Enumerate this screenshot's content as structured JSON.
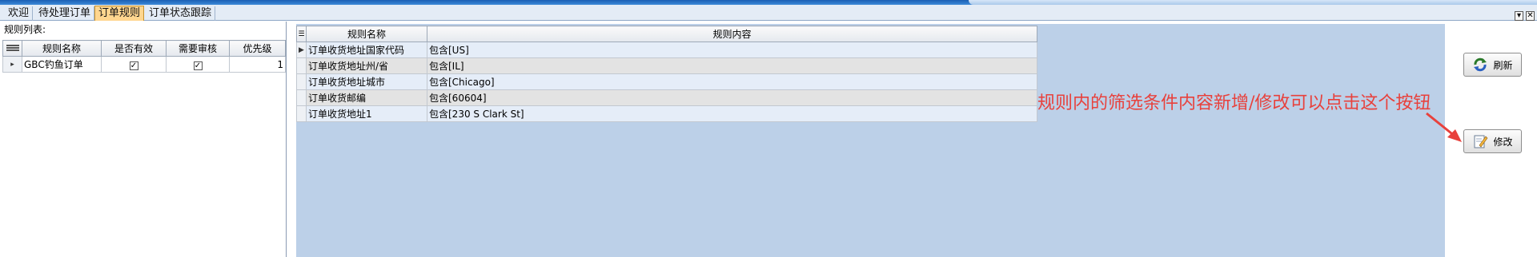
{
  "tabs": [
    {
      "label": "欢迎",
      "active": false
    },
    {
      "label": "待处理订单",
      "active": false
    },
    {
      "label": "订单规则",
      "active": true
    },
    {
      "label": "订单状态跟踪",
      "active": false
    }
  ],
  "window_controls": {
    "restore": "▾",
    "close": "✕"
  },
  "left_panel": {
    "title": "规则列表:",
    "columns": [
      "规则名称",
      "是否有效",
      "需要审核",
      "优先级"
    ],
    "rows": [
      {
        "name": "GBC钓鱼订单",
        "valid": true,
        "review": true,
        "priority": "1"
      }
    ]
  },
  "rule_grid": {
    "columns": [
      "规则名称",
      "规则内容"
    ],
    "rows": [
      {
        "name": "订单收货地址国家代码",
        "content": "包含[US]"
      },
      {
        "name": "订单收货地址州/省",
        "content": "包含[IL]"
      },
      {
        "name": "订单收货地址城市",
        "content": "包含[Chicago]"
      },
      {
        "name": "订单收货邮编",
        "content": "包含[60604]"
      },
      {
        "name": "订单收货地址1",
        "content": "包含[230 S Clark St]"
      }
    ]
  },
  "buttons": {
    "refresh": "刷新",
    "edit": "修改"
  },
  "annotation": {
    "text": "规则内的筛选条件内容新增/修改可以点击这个按钮",
    "color": "#e8413c"
  },
  "colors": {
    "active_tab": "#ffd68f",
    "grid_bg": "#bcd0e8",
    "title_bar": "#1a5fb4"
  }
}
